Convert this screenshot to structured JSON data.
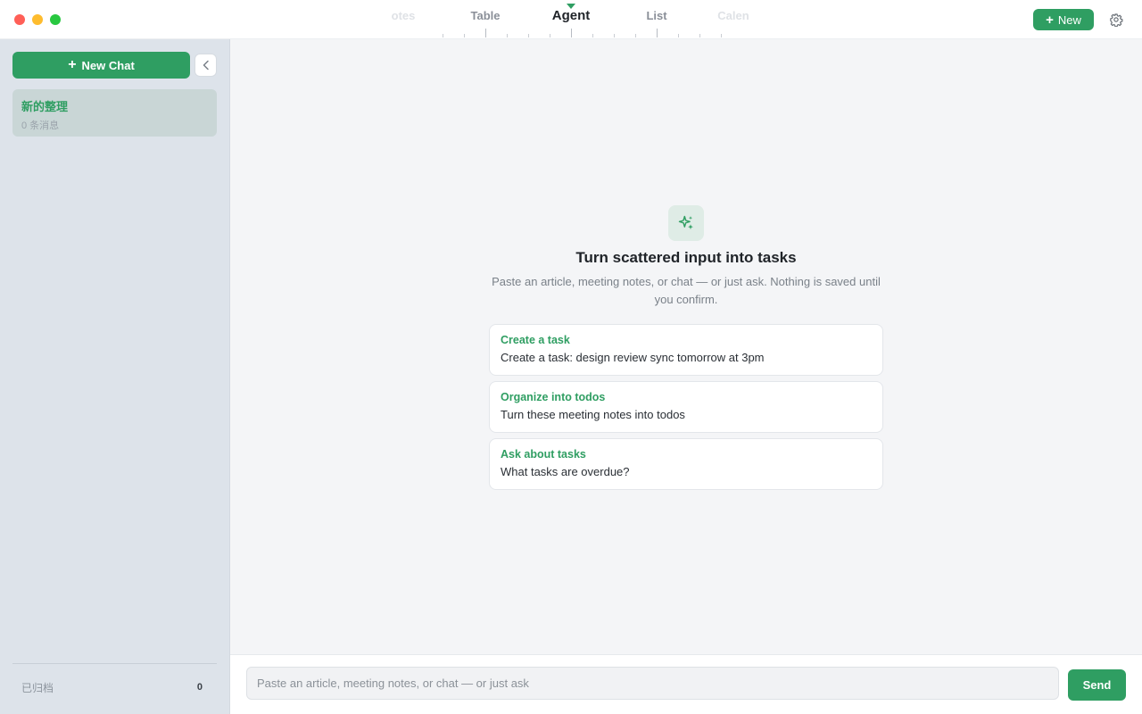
{
  "window": {
    "controls": [
      "close",
      "minimize",
      "maximize"
    ]
  },
  "view_tabs": [
    {
      "label": "otes",
      "state": "faded"
    },
    {
      "label": "Table",
      "state": "normal"
    },
    {
      "label": "Agent",
      "state": "active"
    },
    {
      "label": "List",
      "state": "normal"
    },
    {
      "label": "Calen",
      "state": "faded"
    }
  ],
  "header": {
    "new_label": "New",
    "settings_icon": "gear-icon"
  },
  "sidebar": {
    "new_chat_label": "New Chat",
    "collapse_icon": "chevron-left-icon",
    "chats": [
      {
        "title": "新的整理",
        "subtitle": "0 条消息"
      }
    ],
    "archive": {
      "label": "已归档",
      "count": "0"
    }
  },
  "main": {
    "hero_icon": "sparkles-icon",
    "title": "Turn scattered input into tasks",
    "description": "Paste an article, meeting notes, or chat — or just ask. Nothing is saved until you confirm.",
    "suggestions": [
      {
        "title": "Create a task",
        "text": "Create a task: design review sync tomorrow at 3pm"
      },
      {
        "title": "Organize into todos",
        "text": "Turn these meeting notes into todos"
      },
      {
        "title": "Ask about tasks",
        "text": "What tasks are overdue?"
      }
    ]
  },
  "composer": {
    "placeholder": "Paste an article, meeting notes, or chat — or just ask",
    "value": "",
    "send_label": "Send"
  },
  "colors": {
    "accent": "#2f9e62",
    "sidebar_bg": "#dde3ea",
    "main_bg": "#f4f5f7"
  }
}
